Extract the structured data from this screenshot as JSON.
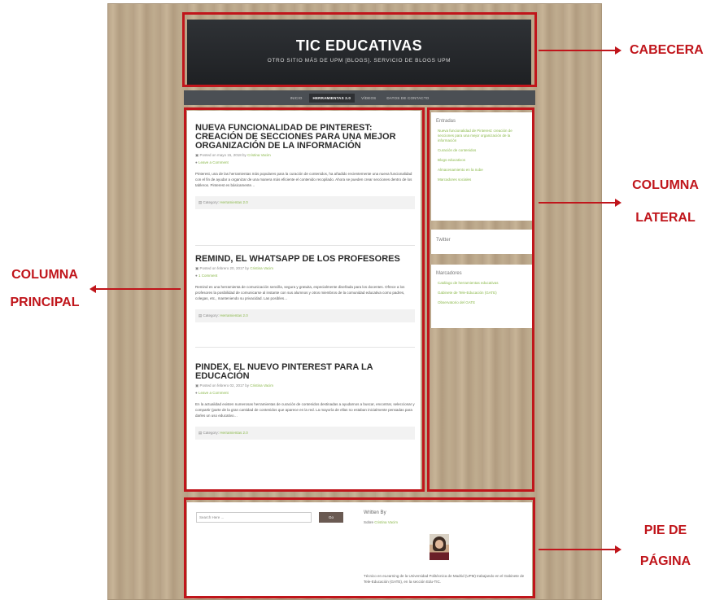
{
  "site": {
    "title": "TIC EDUCATIVAS",
    "tagline": "OTRO SITIO MÁS DE UPM [BLOGS]. SERVICIO DE BLOGS UPM"
  },
  "nav": {
    "items": [
      {
        "label": "INICIO",
        "active": false
      },
      {
        "label": "HERRAMIENTAS 2.0",
        "active": true
      },
      {
        "label": "VÍDEOS",
        "active": false
      },
      {
        "label": "DATOS DE CONTACTO",
        "active": false
      }
    ]
  },
  "posts": [
    {
      "title": "NUEVA FUNCIONALIDAD DE PINTEREST: CREACIÓN DE SECCIONES PARA UNA MEJOR ORGANIZACIÓN DE LA INFORMACIÓN",
      "meta_date": "Posted on mayo 15, 2018 by",
      "author": "Cristina Vacim",
      "comment": "Leave a Comment",
      "excerpt": "Pinterest, una de las herramientas más populares para la curación de contenidos, ha añadido recientemente una nueva funcionalidad con el fin de ayudar a organizar de una manera más eficiente el contenido recopilado. Ahora se pueden crear secciones dentro de los tableros. Pinterest es básicamente…",
      "category_label": "Category:",
      "category": "Herramientas 2.0"
    },
    {
      "title": "REMIND, EL WHATSAPP DE LOS PROFESORES",
      "meta_date": "Posted on febrero 20, 2017 by",
      "author": "Cristina Vacim",
      "comment": "1 Comment",
      "excerpt": "Remind es una herramienta de comunicación sencilla, segura y gratuita, especialmente diseñada para los docentes. Ofrece a los profesores la posibilidad de comunicarse al instante con sus alumnos y otros miembros de la comunidad educativa como padres, colegas, etc., manteniendo su privacidad. Las posibles…",
      "category_label": "Category:",
      "category": "Herramientas 2.0"
    },
    {
      "title": "PINDEX, EL NUEVO PINTEREST PARA LA EDUCACIÓN",
      "meta_date": "Posted on febrero 02, 2017 by",
      "author": "Cristina Vacim",
      "comment": "Leave a Comment",
      "excerpt": "En la actualidad existen numerosas herramientas de curación de contenidos destinadas a ayudarnos a buscar, encontrar, seleccionar y compartir (parte de la gran cantidad de contenidos que aparece en la red. La mayoría de ellas no estaban inicialmente pensadas para darles un uso educativo…",
      "category_label": "Category:",
      "category": "Herramientas 2.0"
    }
  ],
  "sidebar": {
    "entradas": {
      "title": "Entradas",
      "links": [
        "Nueva funcionalidad de Pinterest: creación de secciones para una mejor organización de la información",
        "Curación de contenidos",
        "Blogs educativos",
        "Almacenamiento en la nube",
        "Marcadores sociales"
      ]
    },
    "twitter": {
      "title": "Twitter"
    },
    "marcadores": {
      "title": "Marcadores",
      "links": [
        "Catálogo de herramientas educativas",
        "Gabinete de Tele-Educación (GATE)",
        "Observatorio del GATE"
      ]
    }
  },
  "footer": {
    "search_placeholder": "Search Here ...",
    "search_button": "Go",
    "written_by": "Written By",
    "sobre_label": "Sobre",
    "sobre_author": "Cristina Vacim",
    "bio": "Técnico en eLearning de la Universidad Politécnica de Madrid (UPM) trabajando en el Gabinete de Tele-Educación (GATE), en la sección Edu-TIC."
  },
  "annotations": {
    "cabecera": "CABECERA",
    "columna_lateral_1": "COLUMNA",
    "columna_lateral_2": "LATERAL",
    "columna_principal_1": "COLUMNA",
    "columna_principal_2": "PRINCIPAL",
    "pie_1": "PIE DE",
    "pie_2": "PÁGINA"
  },
  "colors": {
    "highlight": "#c0151b",
    "link_green": "#8ab84a",
    "header_bg": "#25282b"
  }
}
